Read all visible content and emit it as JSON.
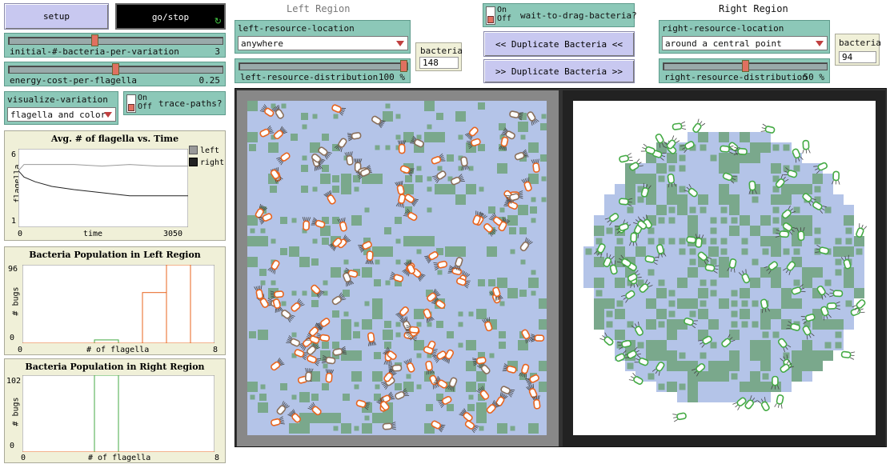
{
  "controls": {
    "setup_label": "setup",
    "gostop_label": "go/stop",
    "initial_bacteria": {
      "label": "initial-#-bacteria-per-variation",
      "value": "3",
      "fraction": 0.4
    },
    "energy_cost": {
      "label": "energy-cost-per-flagella",
      "value": "0.25",
      "fraction": 0.5
    },
    "visualize": {
      "label": "visualize-variation",
      "value": "flagella and color"
    },
    "trace_paths": {
      "label": "trace-paths?",
      "on": "On",
      "off": "Off"
    }
  },
  "left_region": {
    "title": "Left Region",
    "location": {
      "label": "left-resource-location",
      "value": "anywhere"
    },
    "distribution": {
      "label": "left-resource-distribution",
      "value": "100 %",
      "fraction": 1.0
    },
    "bacteria_monitor": {
      "label": "bacteria",
      "value": "148"
    }
  },
  "right_region": {
    "title": "Right Region",
    "location": {
      "label": "right-resource-location",
      "value": "around a central point"
    },
    "distribution": {
      "label": "right-resource-distribution",
      "value": "50 %",
      "fraction": 0.5
    },
    "bacteria_monitor": {
      "label": "bacteria",
      "value": "94"
    }
  },
  "middle": {
    "wait_to_drag": {
      "label": "wait-to-drag-bacteria?",
      "on": "On",
      "off": "Off"
    },
    "dup_left_label": "<< Duplicate Bacteria <<",
    "dup_right_label": ">> Duplicate Bacteria >>"
  },
  "plots": {
    "avg": {
      "title": "Avg. # of flagella vs. Time",
      "ylabel": "flagella",
      "xlabel": "time",
      "xmin": "0",
      "xmax": "3050",
      "ymin": "1",
      "ymax": "6",
      "legend": [
        {
          "name": "left",
          "color": "#999999"
        },
        {
          "name": "right",
          "color": "#222222"
        }
      ]
    },
    "left_pop": {
      "title": "Bacteria Population in Left Region",
      "ylabel": "# bugs",
      "xlabel": "# of flagella",
      "xmin": "0",
      "xmax": "8",
      "ymin": "0",
      "ymax": "96"
    },
    "right_pop": {
      "title": "Bacteria Population in Right Region",
      "ylabel": "# bugs",
      "xlabel": "# of flagella",
      "xmin": "0",
      "xmax": "8",
      "ymin": "0",
      "ymax": "102"
    }
  },
  "chart_data": [
    {
      "type": "line",
      "title": "Avg. # of flagella vs. Time",
      "xlabel": "time",
      "ylabel": "flagella",
      "xlim": [
        0,
        3050
      ],
      "ylim": [
        1,
        6
      ],
      "series": [
        {
          "name": "left",
          "color": "#999999",
          "x": [
            0,
            100,
            300,
            600,
            1000,
            1500,
            2000,
            2500,
            3050
          ],
          "values": [
            4.6,
            5.0,
            5.0,
            5.0,
            5.0,
            4.9,
            5.0,
            4.9,
            4.9
          ]
        },
        {
          "name": "right",
          "color": "#222222",
          "x": [
            0,
            100,
            300,
            600,
            1000,
            1500,
            2000,
            2500,
            3050
          ],
          "values": [
            4.6,
            4.2,
            3.9,
            3.6,
            3.4,
            3.2,
            3.0,
            3.0,
            3.0
          ]
        }
      ]
    },
    {
      "type": "bar",
      "title": "Bacteria Population in Left Region",
      "xlabel": "# of flagella",
      "ylabel": "# bugs",
      "xlim": [
        0,
        8
      ],
      "ylim": [
        0,
        96
      ],
      "categories": [
        0,
        1,
        2,
        3,
        4,
        5,
        6,
        7
      ],
      "series": [
        {
          "color": "#5555ff",
          "values": [
            0,
            0,
            0,
            0,
            0,
            0,
            0,
            0
          ]
        },
        {
          "color": "#44aa44",
          "values": [
            0,
            0,
            0,
            4,
            0,
            0,
            0,
            0
          ]
        },
        {
          "color": "#e8641e",
          "values": [
            0,
            0,
            0,
            0,
            0,
            62,
            96,
            0
          ]
        }
      ]
    },
    {
      "type": "bar",
      "title": "Bacteria Population in Right Region",
      "xlabel": "# of flagella",
      "ylabel": "# bugs",
      "xlim": [
        0,
        8
      ],
      "ylim": [
        0,
        102
      ],
      "categories": [
        0,
        1,
        2,
        3,
        4,
        5,
        6,
        7
      ],
      "series": [
        {
          "color": "#44aa44",
          "values": [
            0,
            0,
            0,
            102,
            0,
            0,
            0,
            0
          ]
        },
        {
          "color": "#e8641e",
          "values": [
            0,
            0,
            0,
            0,
            0,
            0,
            0,
            0
          ]
        }
      ]
    }
  ],
  "colors": {
    "panel_bg": "#8cc8b8",
    "button_bg": "#c8c8f0",
    "left_bacteria": "#e8641e",
    "left_bacteria_alt": "#8a6f5a",
    "right_bacteria": "#44aa44",
    "resource_light": "#b4c4e8",
    "resource_dark": "#7aa88c"
  }
}
